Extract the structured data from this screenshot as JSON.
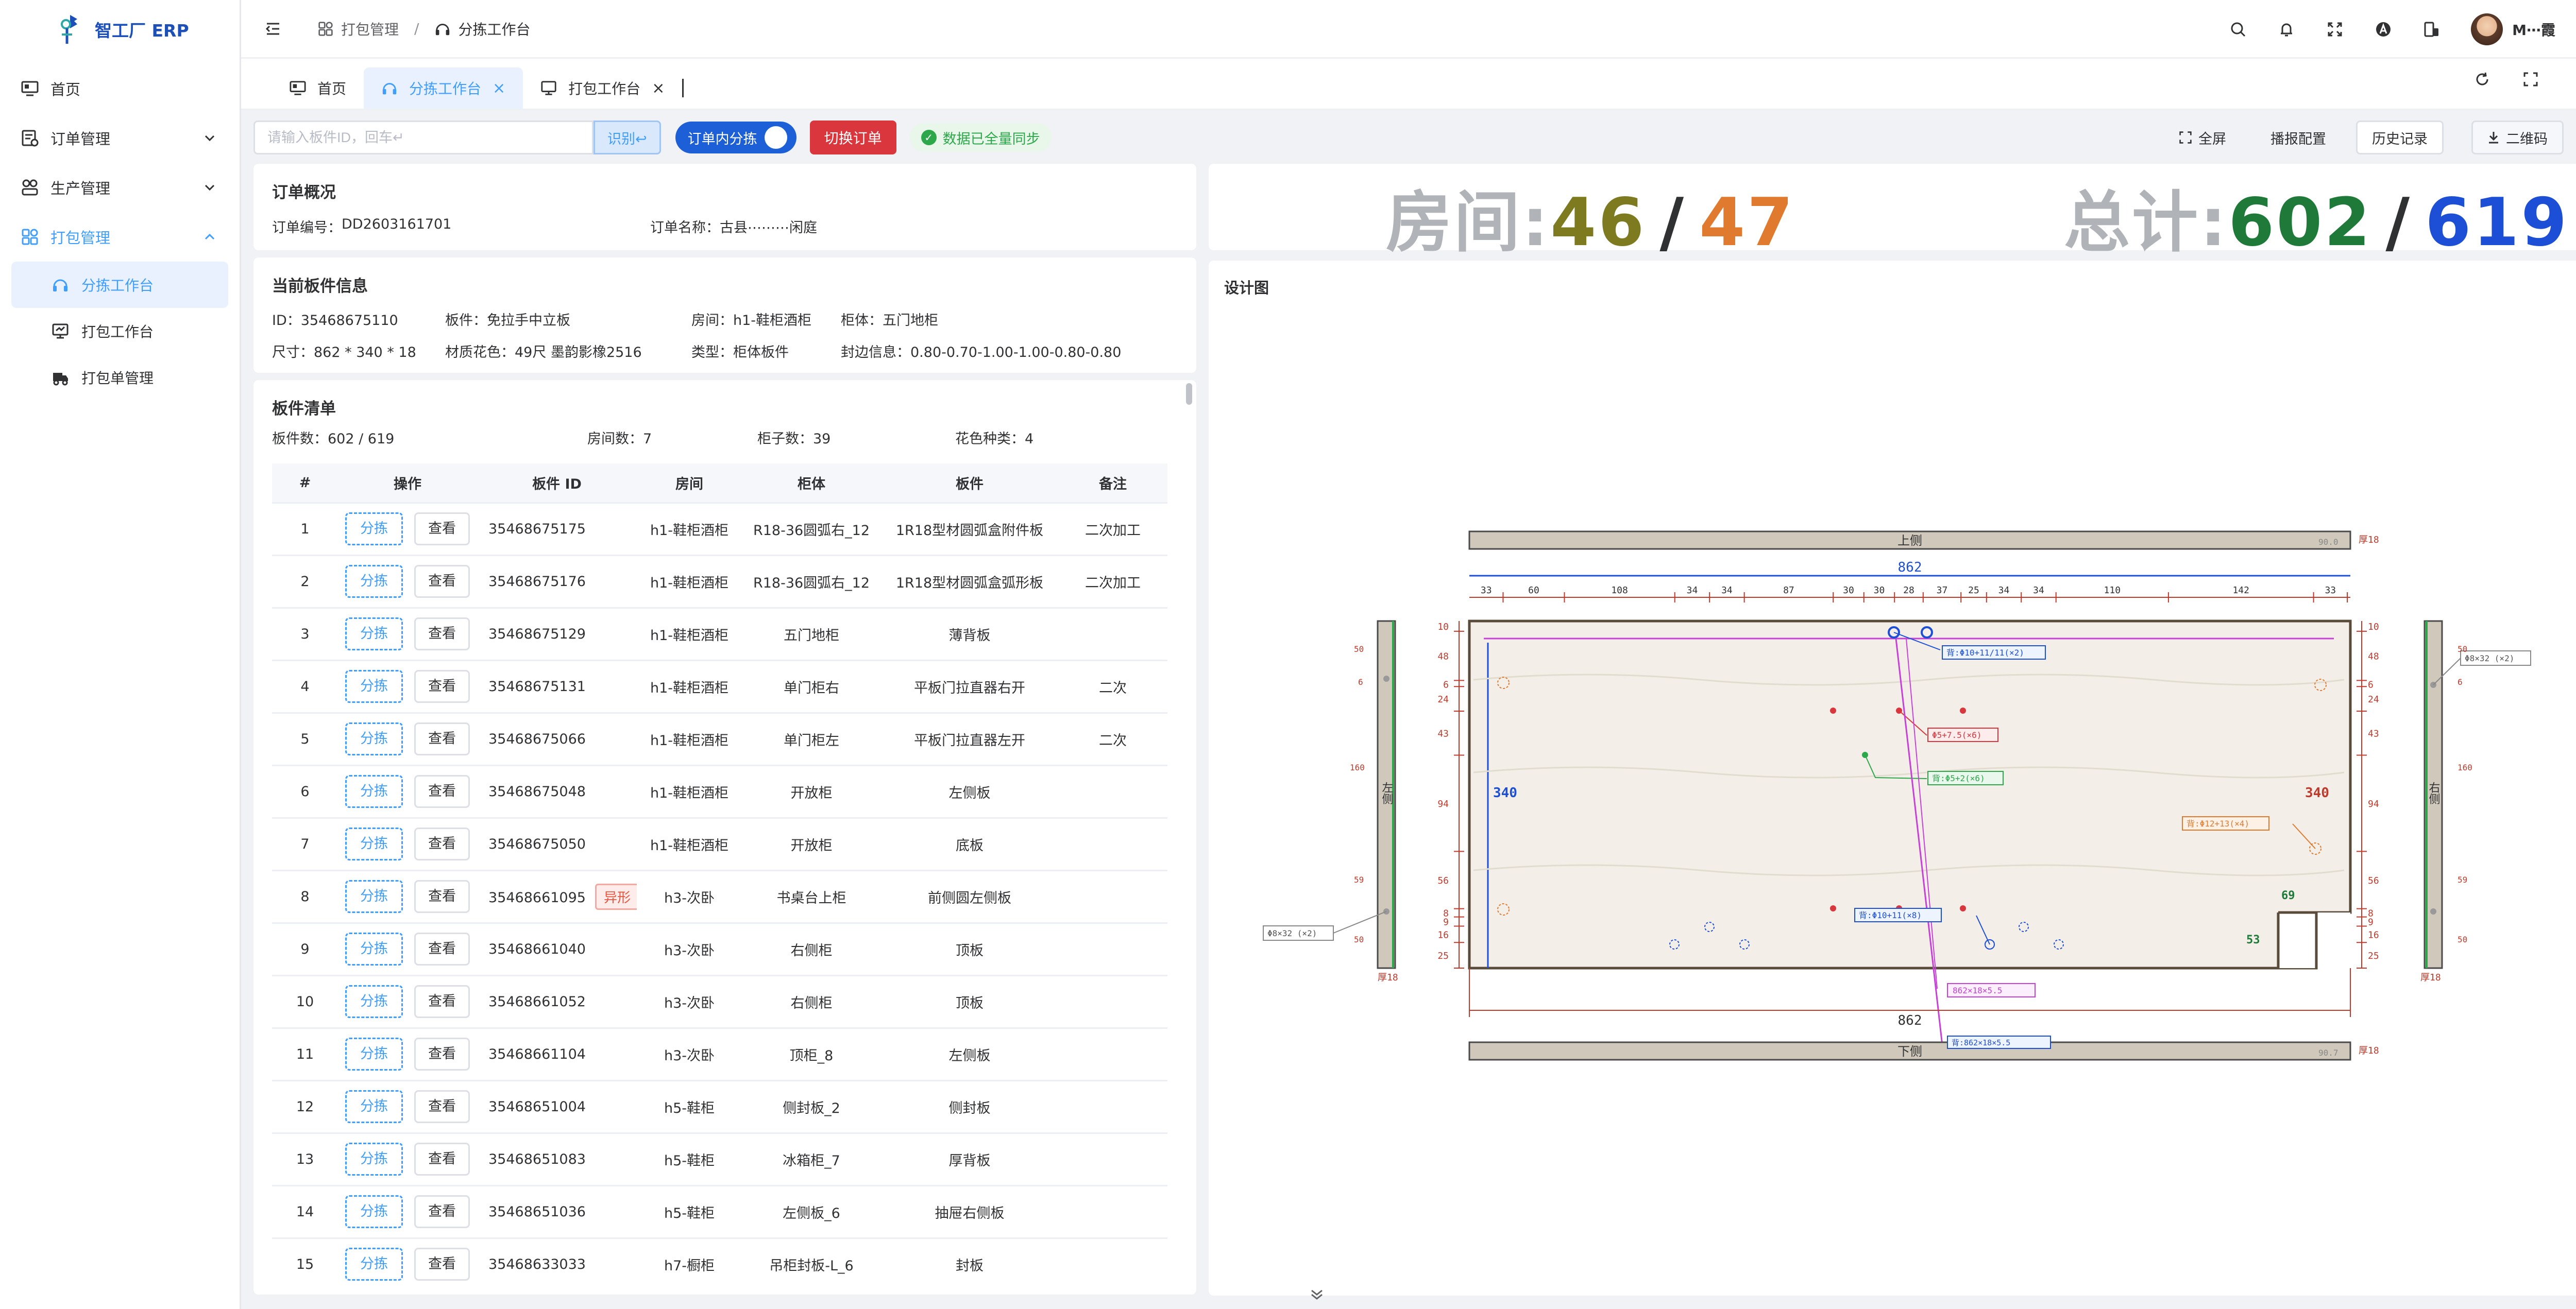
{
  "app": {
    "name": "智工厂 ERP",
    "user_name": "M⋯霞"
  },
  "sidebar": {
    "items": [
      {
        "label": "首页",
        "icon": "monitor-icon"
      },
      {
        "label": "订单管理",
        "icon": "order-icon"
      },
      {
        "label": "生产管理",
        "icon": "production-icon"
      },
      {
        "label": "打包管理",
        "icon": "package-icon"
      }
    ],
    "subitems": [
      {
        "label": "分拣工作台",
        "icon": "headset-icon"
      },
      {
        "label": "打包工作台",
        "icon": "desk-icon"
      },
      {
        "label": "打包单管理",
        "icon": "truck-icon"
      }
    ]
  },
  "header": {
    "breadcrumb": [
      "打包管理",
      "分拣工作台"
    ],
    "breadcrumb_sep": "/"
  },
  "tabs": [
    {
      "label": "首页"
    },
    {
      "label": "分拣工作台",
      "close": "×"
    },
    {
      "label": "打包工作台",
      "close": "×"
    }
  ],
  "toolbar": {
    "search_placeholder": "请输入板件ID，回车↵",
    "identify_label": "识别↩",
    "toggle_label": "订单内分拣",
    "switch_label": "切换订单",
    "sync_label": "数据已全量同步",
    "sync_icon": "✓",
    "fullscreen_label": "全屏",
    "broadcast_label": "播报配置",
    "history_label": "历史记录",
    "qrcode_label": "二维码"
  },
  "order": {
    "title": "订单概况",
    "no_label": "订单编号：",
    "no_value": "DD2603161701",
    "name_label": "订单名称：",
    "name_value": "古县⋯⋯⋯闲庭"
  },
  "stats": {
    "room_label": "房间:",
    "room_done": "46",
    "sep": "/",
    "room_total": "47",
    "total_label": "总计:",
    "total_done": "602",
    "total_total": "619",
    "colors": {
      "room_done": "#7d7a20",
      "room_total": "#e07a2e",
      "total_done": "#1f7a3a",
      "total_total": "#1d4fd6"
    }
  },
  "current_board": {
    "title": "当前板件信息",
    "id": "ID：35468675110",
    "name": "板件：免拉手中立板",
    "room": "房间：h1-鞋柜酒柜",
    "cabinet": "柜体：五门地柜",
    "size": "尺寸：862 * 340 * 18",
    "material": "材质花色：49尺 墨韵影橡2516",
    "type": "类型：柜体板件",
    "edge": "封边信息：0.80-0.70-1.00-1.00-0.80-0.80"
  },
  "board_list": {
    "title": "板件清单",
    "summary": [
      "板件数：602 / 619",
      "房间数：7",
      "柜子数：39",
      "花色种类：4"
    ],
    "columns": [
      "#",
      "操作",
      "板件 ID",
      "房间",
      "柜体",
      "板件",
      "备注"
    ],
    "sort_label": "分拣",
    "view_label": "查看",
    "rows": [
      {
        "no": "1",
        "id": "35468675175",
        "tag": "",
        "room": "h1-鞋柜酒柜",
        "cabinet": "R18-36圆弧右_12",
        "board": "1R18型材圆弧盒附件板",
        "note": "二次加工"
      },
      {
        "no": "2",
        "id": "35468675176",
        "tag": "",
        "room": "h1-鞋柜酒柜",
        "cabinet": "R18-36圆弧右_12",
        "board": "1R18型材圆弧盒弧形板",
        "note": "二次加工"
      },
      {
        "no": "3",
        "id": "35468675129",
        "tag": "",
        "room": "h1-鞋柜酒柜",
        "cabinet": "五门地柜",
        "board": "薄背板",
        "note": ""
      },
      {
        "no": "4",
        "id": "35468675131",
        "tag": "",
        "room": "h1-鞋柜酒柜",
        "cabinet": "单门柜右",
        "board": "平板门拉直器右开",
        "note": "二次"
      },
      {
        "no": "5",
        "id": "35468675066",
        "tag": "",
        "room": "h1-鞋柜酒柜",
        "cabinet": "单门柜左",
        "board": "平板门拉直器左开",
        "note": "二次"
      },
      {
        "no": "6",
        "id": "35468675048",
        "tag": "",
        "room": "h1-鞋柜酒柜",
        "cabinet": "开放柜",
        "board": "左侧板",
        "note": ""
      },
      {
        "no": "7",
        "id": "35468675050",
        "tag": "",
        "room": "h1-鞋柜酒柜",
        "cabinet": "开放柜",
        "board": "底板",
        "note": ""
      },
      {
        "no": "8",
        "id": "35468661095",
        "tag": "异形",
        "room": "h3-次卧",
        "cabinet": "书桌台上柜",
        "board": "前侧圆左侧板",
        "note": ""
      },
      {
        "no": "9",
        "id": "35468661040",
        "tag": "",
        "room": "h3-次卧",
        "cabinet": "右侧柜",
        "board": "顶板",
        "note": ""
      },
      {
        "no": "10",
        "id": "35468661052",
        "tag": "",
        "room": "h3-次卧",
        "cabinet": "右侧柜",
        "board": "顶板",
        "note": ""
      },
      {
        "no": "11",
        "id": "35468661104",
        "tag": "",
        "room": "h3-次卧",
        "cabinet": "顶柜_8",
        "board": "左侧板",
        "note": ""
      },
      {
        "no": "12",
        "id": "35468651004",
        "tag": "",
        "room": "h5-鞋柜",
        "cabinet": "侧封板_2",
        "board": "侧封板",
        "note": ""
      },
      {
        "no": "13",
        "id": "35468651083",
        "tag": "",
        "room": "h5-鞋柜",
        "cabinet": "冰箱柜_7",
        "board": "厚背板",
        "note": ""
      },
      {
        "no": "14",
        "id": "35468651036",
        "tag": "",
        "room": "h5-鞋柜",
        "cabinet": "左侧板_6",
        "board": "抽屉右侧板",
        "note": ""
      },
      {
        "no": "15",
        "id": "35468633033",
        "tag": "",
        "room": "h7-橱柜",
        "cabinet": "吊柜封板-L_6",
        "board": "封板",
        "note": ""
      }
    ]
  },
  "design": {
    "title": "设计图",
    "top_label": "上侧",
    "bottom_label": "下侧",
    "left_label": "左侧",
    "right_label": "右侧",
    "thick_label": "厚18",
    "thick_small": "90.0",
    "thick_small_bottom": "90.7",
    "width_label": "862",
    "height_label": "340",
    "top_dims": [
      "33",
      "60",
      "108",
      "34",
      "34",
      "87",
      "30",
      "30",
      "28",
      "37",
      "25",
      "34",
      "34",
      "110",
      "142",
      "33"
    ],
    "left_dims": [
      "10",
      "48",
      "6",
      "24",
      "43",
      "94",
      "56",
      "8",
      "9",
      "16",
      "25"
    ],
    "right_dims": [
      "10",
      "48",
      "6",
      "24",
      "43",
      "94",
      "56",
      "8",
      "9",
      "16",
      "25"
    ],
    "notch_w": "69",
    "notch_h": "53",
    "side_dims": [
      "50",
      "6",
      "160",
      "59",
      "50"
    ],
    "hole_labels": [
      "背:Φ10+11/11(×2)",
      "Φ5+7.5(×6)",
      "背:Φ5+2(×6)",
      "背:Φ12+13(×4)",
      "背:Φ10+11(×8)",
      "Φ8×32 (×2)",
      "Φ8×32 (×2)",
      "862×18×5.5",
      "背:862×18×5.5"
    ]
  }
}
